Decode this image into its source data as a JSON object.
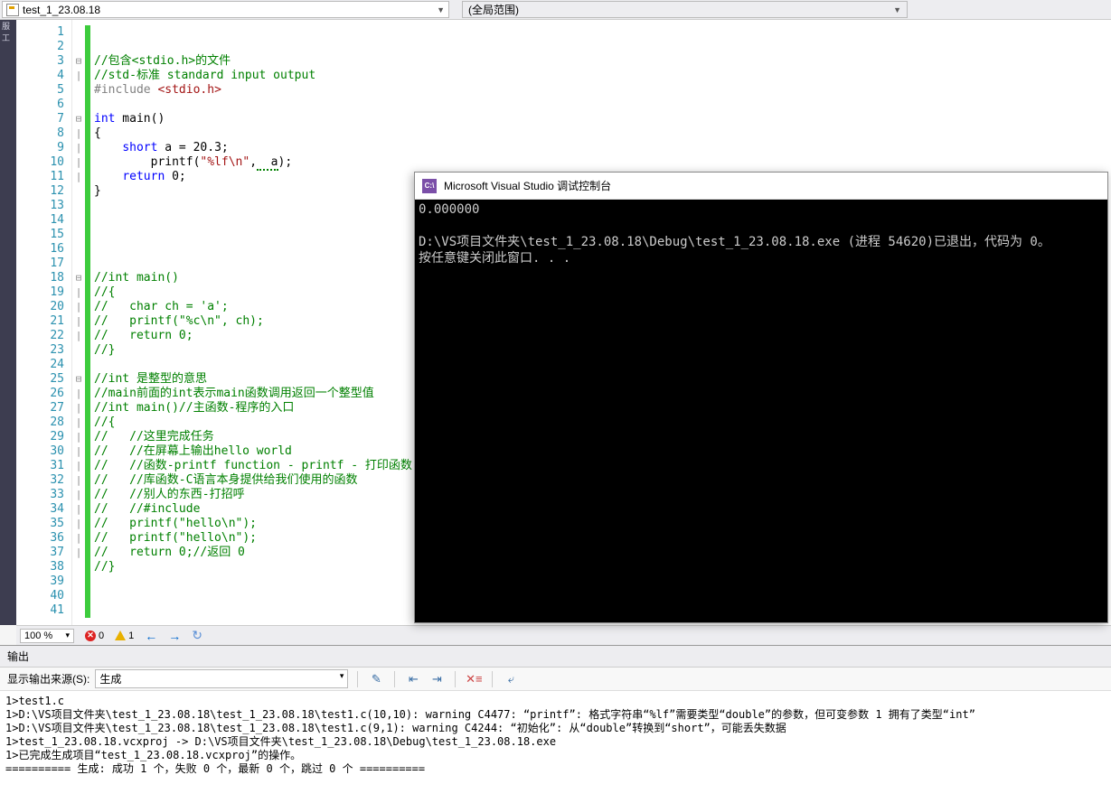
{
  "topbar": {
    "file_name": "test_1_23.08.18",
    "scope_label": "(全局范围)"
  },
  "code_lines": [
    {
      "n": 1,
      "fold": "",
      "html": ""
    },
    {
      "n": 2,
      "fold": "",
      "html": ""
    },
    {
      "n": 3,
      "fold": "⊟",
      "html": "<span class='comment'>//包含&lt;stdio.h&gt;的文件</span>"
    },
    {
      "n": 4,
      "fold": "|",
      "html": "<span class='comment'>//std-标准 standard input output</span>"
    },
    {
      "n": 5,
      "fold": "",
      "html": "<span class='preproc'>#include </span><span class='include-path'>&lt;stdio.h&gt;</span>"
    },
    {
      "n": 6,
      "fold": "",
      "html": ""
    },
    {
      "n": 7,
      "fold": "⊟",
      "html": "<span class='keyword'>int</span> main()"
    },
    {
      "n": 8,
      "fold": "|",
      "html": "{"
    },
    {
      "n": 9,
      "fold": "|",
      "html": "    <span class='keyword'>short</span> a = 20.3;"
    },
    {
      "n": 10,
      "fold": "|",
      "html": "        printf(<span class='string'>\"%lf\\n\"</span>,<span class='squiggle'>  a</span>);"
    },
    {
      "n": 11,
      "fold": "|",
      "html": "    <span class='keyword'>return</span> 0;"
    },
    {
      "n": 12,
      "fold": "",
      "html": "}"
    },
    {
      "n": 13,
      "fold": "",
      "html": ""
    },
    {
      "n": 14,
      "fold": "",
      "html": ""
    },
    {
      "n": 15,
      "fold": "",
      "html": ""
    },
    {
      "n": 16,
      "fold": "",
      "html": ""
    },
    {
      "n": 17,
      "fold": "",
      "html": ""
    },
    {
      "n": 18,
      "fold": "⊟",
      "html": "<span class='comment'>//int main()</span>"
    },
    {
      "n": 19,
      "fold": "|",
      "html": "<span class='comment'>//{</span>"
    },
    {
      "n": 20,
      "fold": "|",
      "html": "<span class='comment'>//   char ch = 'a';</span>"
    },
    {
      "n": 21,
      "fold": "|",
      "html": "<span class='comment'>//   printf(\"%c\\n\", ch);</span>"
    },
    {
      "n": 22,
      "fold": "|",
      "html": "<span class='comment'>//   return 0;</span>"
    },
    {
      "n": 23,
      "fold": "",
      "html": "<span class='comment'>//}</span>"
    },
    {
      "n": 24,
      "fold": "",
      "html": ""
    },
    {
      "n": 25,
      "fold": "⊟",
      "html": "<span class='comment'>//int 是整型的意思</span>"
    },
    {
      "n": 26,
      "fold": "|",
      "html": "<span class='comment'>//main前面的int表示main函数调用返回一个整型值</span>"
    },
    {
      "n": 27,
      "fold": "|",
      "html": "<span class='comment'>//int main()//主函数-程序的入口</span>"
    },
    {
      "n": 28,
      "fold": "|",
      "html": "<span class='comment'>//{</span>"
    },
    {
      "n": 29,
      "fold": "|",
      "html": "<span class='comment'>//   //这里完成任务</span>"
    },
    {
      "n": 30,
      "fold": "|",
      "html": "<span class='comment'>//   //在屏幕上输出hello world</span>"
    },
    {
      "n": 31,
      "fold": "|",
      "html": "<span class='comment'>//   //函数-printf function - printf - 打印函数</span>"
    },
    {
      "n": 32,
      "fold": "|",
      "html": "<span class='comment'>//   //库函数-C语言本身提供给我们使用的函数</span>"
    },
    {
      "n": 33,
      "fold": "|",
      "html": "<span class='comment'>//   //别人的东西-打招呼</span>"
    },
    {
      "n": 34,
      "fold": "|",
      "html": "<span class='comment'>//   //#include</span>"
    },
    {
      "n": 35,
      "fold": "|",
      "html": "<span class='comment'>//   printf(\"hello\\n\");</span>"
    },
    {
      "n": 36,
      "fold": "|",
      "html": "<span class='comment'>//   printf(\"hello\\n\");</span>"
    },
    {
      "n": 37,
      "fold": "|",
      "html": "<span class='comment'>//   return 0;//返回 0</span>"
    },
    {
      "n": 38,
      "fold": "",
      "html": "<span class='comment'>//}</span>"
    },
    {
      "n": 39,
      "fold": "",
      "html": ""
    },
    {
      "n": 40,
      "fold": "",
      "html": ""
    },
    {
      "n": 41,
      "fold": "",
      "html": ""
    }
  ],
  "zoom": {
    "level": "100 %",
    "errors": "0",
    "warnings": "1"
  },
  "console": {
    "title": "Microsoft Visual Studio 调试控制台",
    "body": "0.000000\n\nD:\\VS项目文件夹\\test_1_23.08.18\\Debug\\test_1_23.08.18.exe (进程 54620)已退出，代码为 0。\n按任意键关闭此窗口. . ."
  },
  "output": {
    "header": "输出",
    "source_label": "显示输出来源(S):",
    "source_value": "生成",
    "body": "1>test1.c\n1>D:\\VS项目文件夹\\test_1_23.08.18\\test_1_23.08.18\\test1.c(10,10): warning C4477: “printf”: 格式字符串“%lf”需要类型“double”的参数，但可变参数 1 拥有了类型“int”\n1>D:\\VS项目文件夹\\test_1_23.08.18\\test_1_23.08.18\\test1.c(9,1): warning C4244: “初始化”: 从“double”转换到“short”，可能丢失数据\n1>test_1_23.08.18.vcxproj -> D:\\VS项目文件夹\\test_1_23.08.18\\Debug\\test_1_23.08.18.exe\n1>已完成生成项目“test_1_23.08.18.vcxproj”的操作。\n========== 生成: 成功 1 个，失败 0 个，最新 0 个，跳过 0 个 =========="
  }
}
